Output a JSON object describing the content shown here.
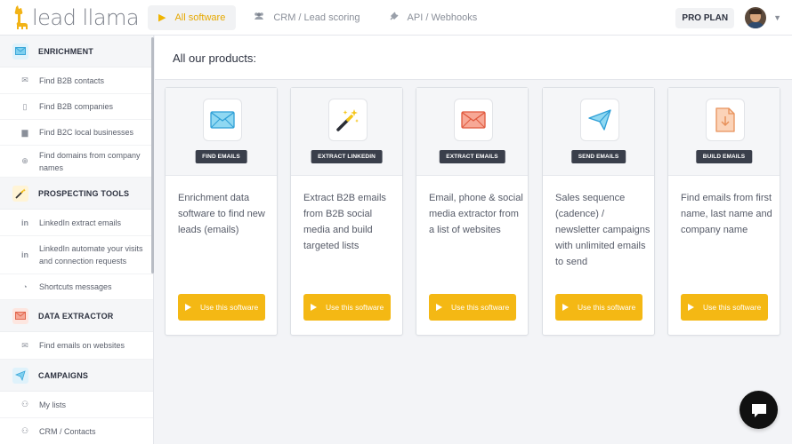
{
  "app": {
    "logo_text": "lead llama"
  },
  "nav": {
    "tabs": [
      {
        "label": "All software",
        "icon": "play-icon",
        "active": true
      },
      {
        "label": "CRM / Lead scoring",
        "icon": "users-icon",
        "active": false
      },
      {
        "label": "API / Webhooks",
        "icon": "plug-icon",
        "active": false
      }
    ],
    "plan_label": "PRO PLAN"
  },
  "sidebar": {
    "sections": [
      {
        "label": "ENRICHMENT",
        "icon": "envelope-icon",
        "icon_color": "#3aa6d9",
        "items": [
          {
            "label": "Find B2B contacts",
            "icon": "envelope-icon"
          },
          {
            "label": "Find B2B companies",
            "icon": "building-icon"
          },
          {
            "label": "Find B2C local businesses",
            "icon": "shop-icon"
          },
          {
            "label": "Find domains from company names",
            "icon": "search-icon"
          }
        ]
      },
      {
        "label": "PROSPECTING TOOLS",
        "icon": "magic-wand-icon",
        "icon_color": "#f0b400",
        "items": [
          {
            "label": "LinkedIn extract emails",
            "icon": "linkedin-icon"
          },
          {
            "label": "LinkedIn automate your visits and connection requests",
            "icon": "linkedin-icon"
          },
          {
            "label": "Shortcuts messages",
            "icon": "chat-icon"
          }
        ]
      },
      {
        "label": "DATA EXTRACTOR",
        "icon": "envelope-icon",
        "icon_color": "#e2664d",
        "items": [
          {
            "label": "Find emails on websites",
            "icon": "envelope-icon"
          }
        ]
      },
      {
        "label": "CAMPAIGNS",
        "icon": "paper-plane-icon",
        "icon_color": "#3aa6d9",
        "items": [
          {
            "label": "My lists",
            "icon": "users-icon"
          },
          {
            "label": "CRM / Contacts",
            "icon": "users-icon"
          }
        ]
      }
    ]
  },
  "main": {
    "title": "All our products:",
    "cards": [
      {
        "badge": "FIND EMAILS",
        "icon": "envelope-icon",
        "description": "Enrichment data software to find new leads (emails)",
        "button": "Use this software"
      },
      {
        "badge": "EXTRACT LINKEDIN",
        "icon": "magic-wand-icon",
        "description": "Extract B2B emails from B2B social media and build targeted lists",
        "button": "Use this software"
      },
      {
        "badge": "EXTRACT EMAILS",
        "icon": "envelope-red-icon",
        "description": "Email, phone & social media extractor from a list of websites",
        "button": "Use this software"
      },
      {
        "badge": "SEND EMAILS",
        "icon": "paper-plane-icon",
        "description": "Sales sequence (cadence) / newsletter campaigns with unlimited emails to send",
        "button": "Use this software"
      },
      {
        "badge": "BUILD EMAILS",
        "icon": "download-file-icon",
        "description": "Find emails from first name, last name and company name",
        "button": "Use this software"
      }
    ]
  },
  "colors": {
    "accent": "#f4b814",
    "dark": "#3a3f4b"
  }
}
